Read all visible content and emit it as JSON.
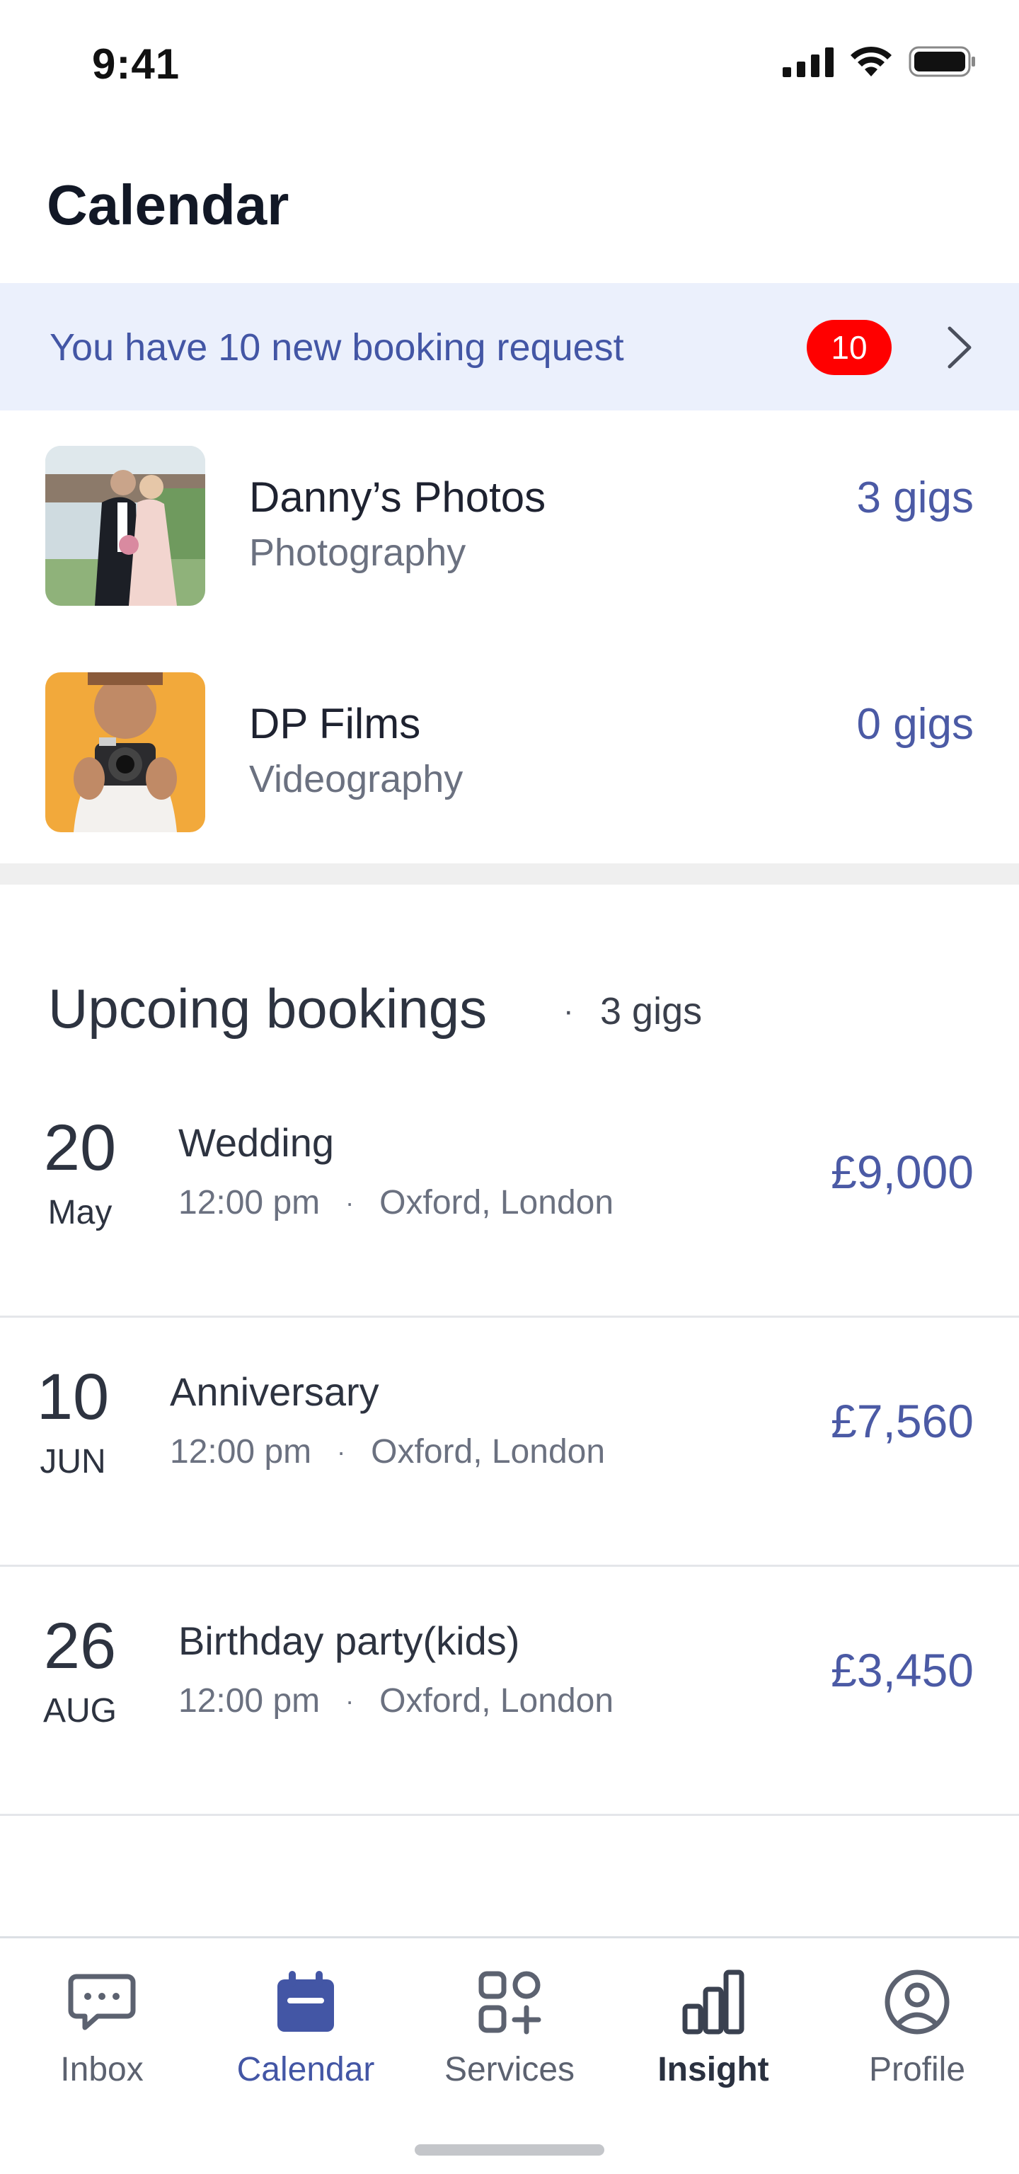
{
  "status_bar": {
    "time": "9:41"
  },
  "page_title": "Calendar",
  "banner": {
    "text": "You have 10 new booking request",
    "badge_count": "10"
  },
  "services": [
    {
      "name": "Danny’s Photos",
      "category": "Photography",
      "gigs": "3 gigs",
      "thumb_icon": "wedding-photo"
    },
    {
      "name": "DP Films",
      "category": "Videography",
      "gigs": "0 gigs",
      "thumb_icon": "photographer-photo"
    }
  ],
  "upcoming": {
    "title": "Upcoing bookings",
    "separator": "·",
    "count": "3 gigs",
    "bookings": [
      {
        "day": "20",
        "month": "May",
        "title": "Wedding",
        "time": "12:00 pm",
        "separator": "·",
        "location": "Oxford, London",
        "price": "£9,000"
      },
      {
        "day": "10",
        "month": "JUN",
        "title": "Anniversary",
        "time": "12:00 pm",
        "separator": "·",
        "location": "Oxford, London",
        "price": "£7,560"
      },
      {
        "day": "26",
        "month": "AUG",
        "title": "Birthday party(kids)",
        "time": "12:00 pm",
        "separator": "·",
        "location": "Oxford, London",
        "price": "£3,450"
      }
    ]
  },
  "tabs": [
    {
      "label": "Inbox",
      "icon": "chat-icon",
      "state": "inactive"
    },
    {
      "label": "Calendar",
      "icon": "calendar-icon",
      "state": "active"
    },
    {
      "label": "Services",
      "icon": "services-grid-icon",
      "state": "inactive"
    },
    {
      "label": "Insight",
      "icon": "bar-chart-icon",
      "state": "bold"
    },
    {
      "label": "Profile",
      "icon": "profile-icon",
      "state": "inactive"
    }
  ],
  "colors": {
    "accent": "#4356a5",
    "banner_bg": "#ebf0fc",
    "badge": "#ff0000",
    "price": "#4b5aa5"
  }
}
